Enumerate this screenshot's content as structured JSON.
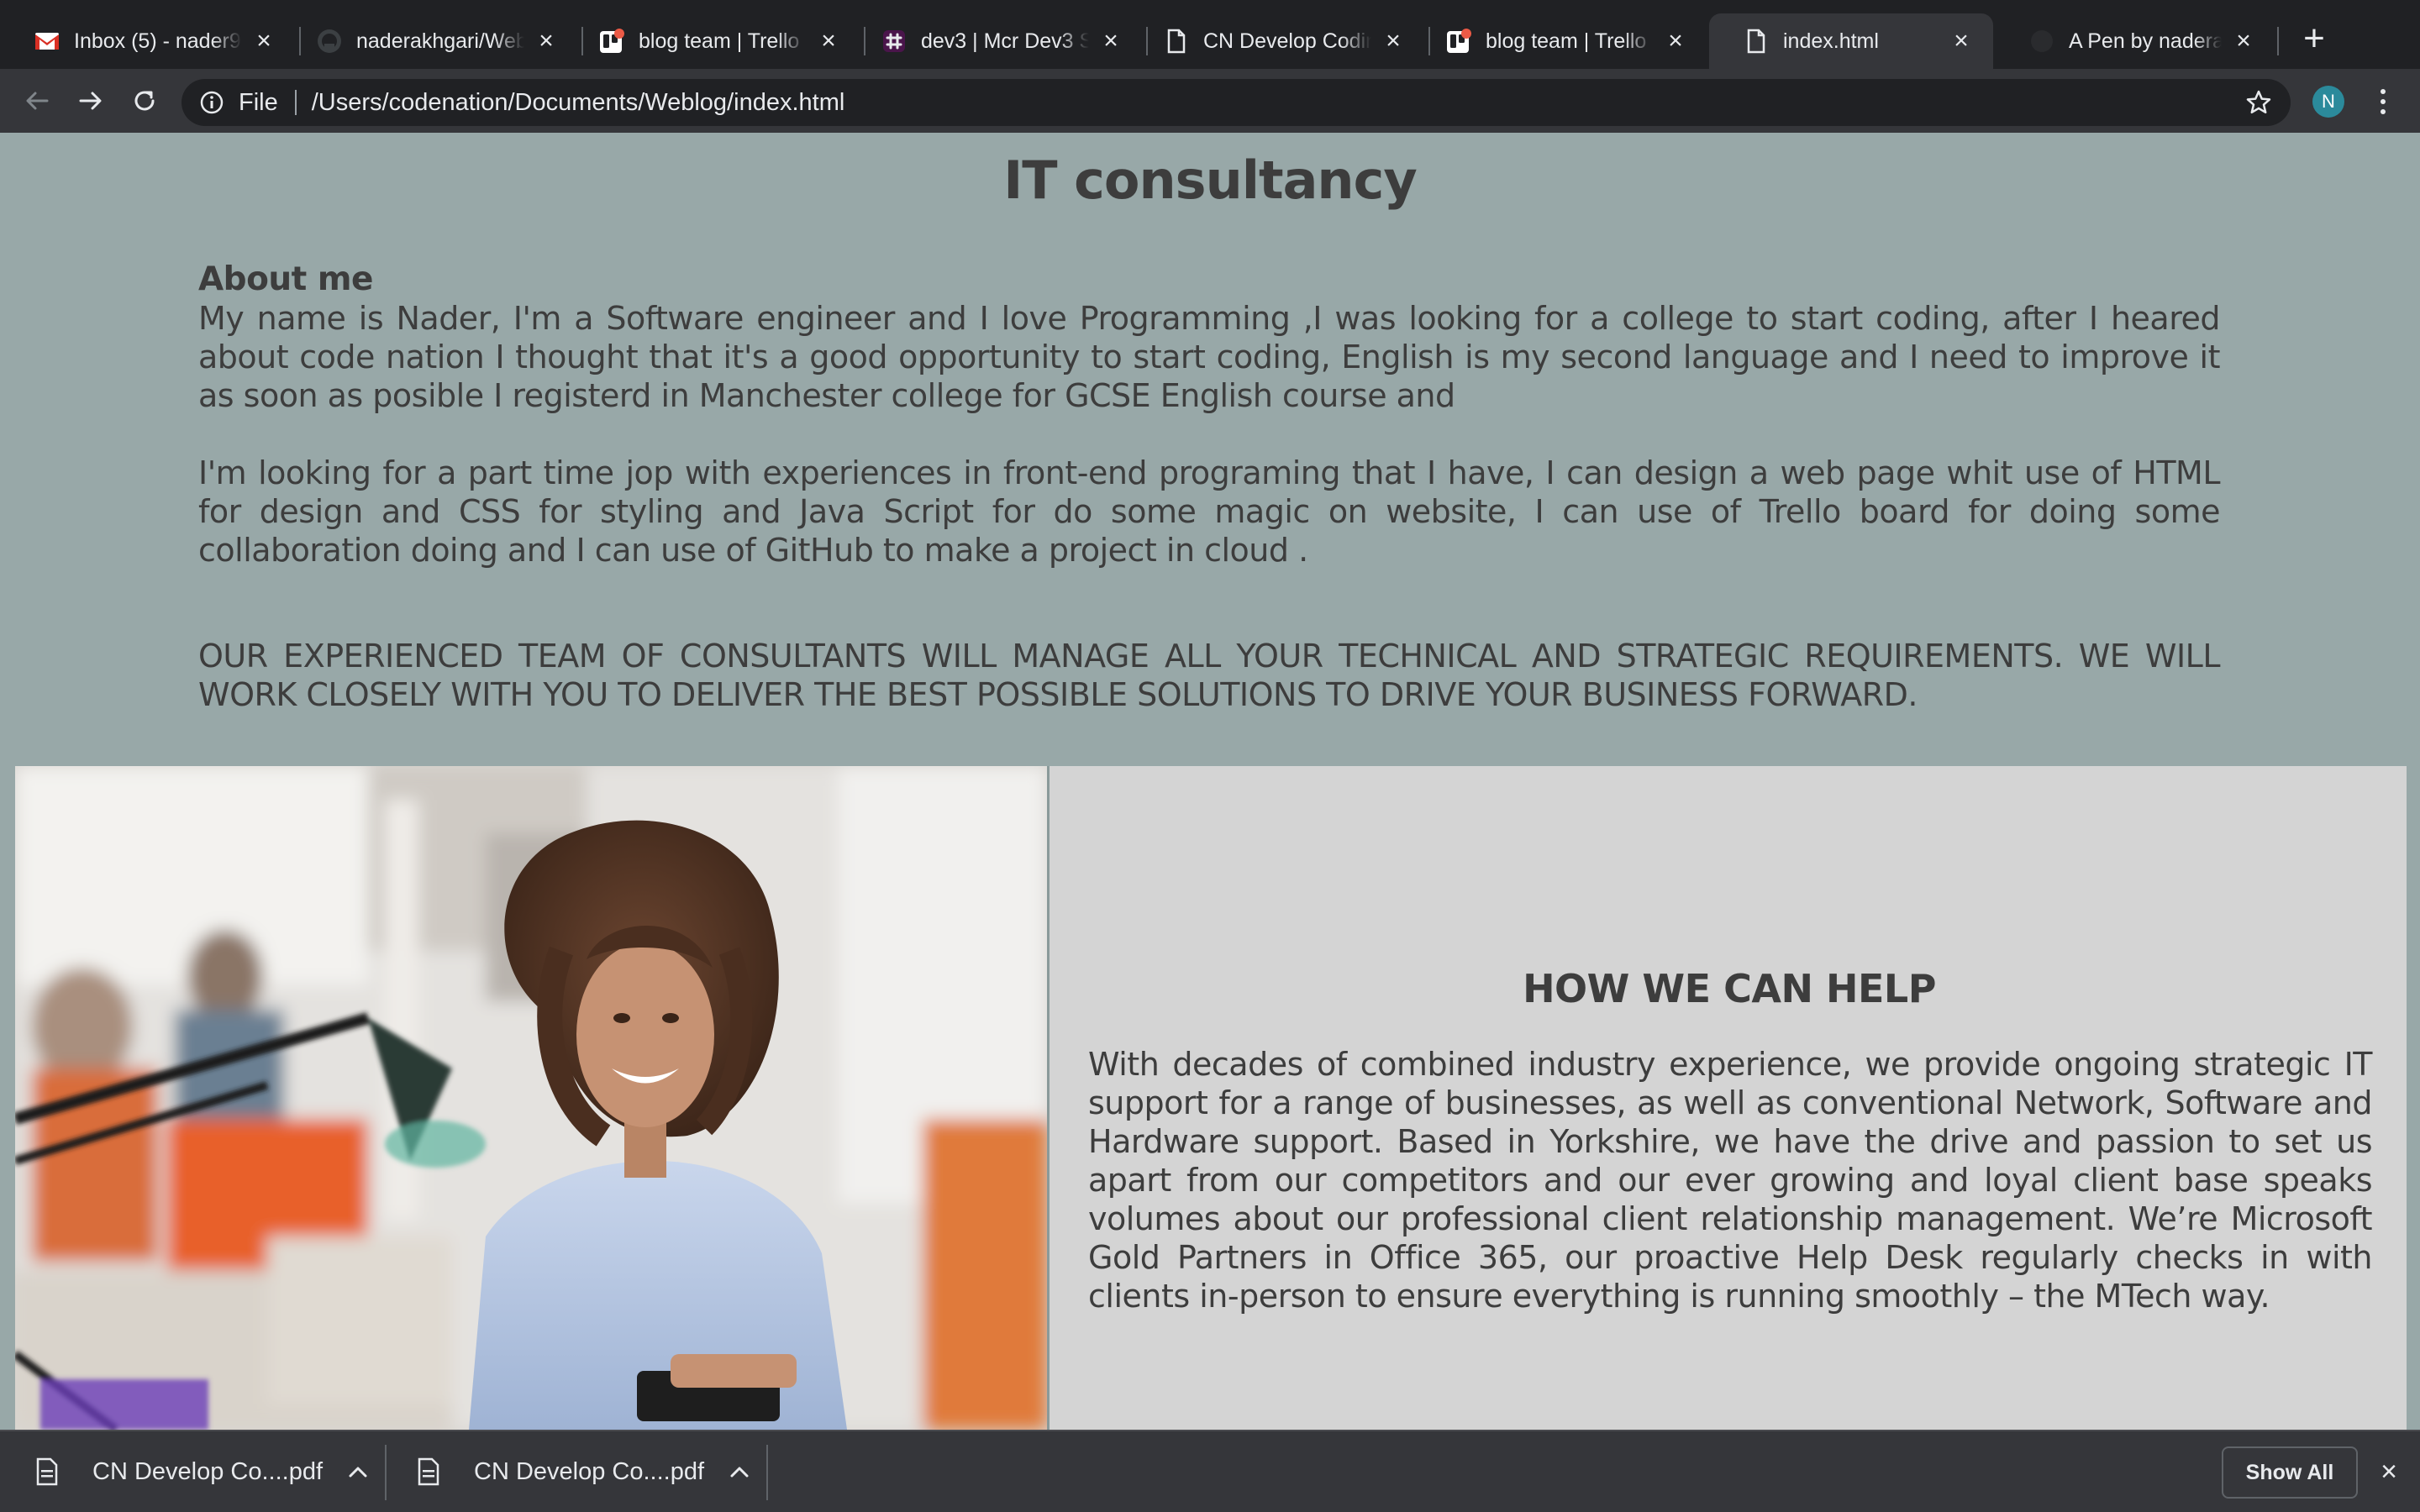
{
  "browser": {
    "tabs": [
      {
        "title": "Inbox (5) - nader9",
        "icon": "gmail-icon"
      },
      {
        "title": "naderakhgari/Web",
        "icon": "github-icon"
      },
      {
        "title": "blog team | Trello",
        "icon": "trello-icon"
      },
      {
        "title": "dev3 | Mcr Dev3 S",
        "icon": "slack-icon"
      },
      {
        "title": "CN Develop Codin",
        "icon": "document-icon"
      },
      {
        "title": "blog team | Trello",
        "icon": "trello-icon"
      },
      {
        "title": "index.html",
        "icon": "document-icon",
        "active": true
      },
      {
        "title": "A Pen by naderakh",
        "icon": "codepen-icon"
      }
    ],
    "address": {
      "scheme": "File",
      "url": "/Users/codenation/Documents/Weblog/index.html"
    },
    "profile_initial": "N"
  },
  "page": {
    "title": "IT consultancy",
    "about": {
      "heading": "About me",
      "paragraph1": "My name is Nader, I'm a Software engineer and I love Programming ,I was looking for a college to start coding, after I heared about code nation I thought that it's a good opportunity to start coding, English is my second language and I need to improve it as soon as posible I registerd in Manchester college for GCSE English course and",
      "paragraph2": "I'm looking for a part time jop with experiences in front-end programing that I have, I can design a web page whit use of HTML for design and CSS for styling and Java Script for do some magic on website, I can use of Trello board for doing some collaboration doing and I can use of GitHub to make a project in cloud ."
    },
    "tagline": "OUR EXPERIENCED TEAM OF CONSULTANTS WILL MANAGE ALL YOUR TECHNICAL AND STRATEGIC REQUIREMENTS. WE WILL WORK CLOSELY WITH YOU TO DELIVER THE BEST POSSIBLE SOLUTIONS TO DRIVE YOUR BUSINESS FORWARD.",
    "help": {
      "heading": "HOW WE CAN HELP",
      "text": "With decades of combined industry experience, we provide ongoing strategic IT support for a range of businesses, as well as conventional Network, Software and Hardware support. Based in Yorkshire, we have the drive and passion to set us apart from our competitors and our ever growing and loyal client base speaks volumes about our professional client relationship management. We’re Microsoft Gold Partners in Office 365, our proactive Help Desk regularly checks in with clients in-person to ensure everything is running smoothly – the MTech way."
    }
  },
  "downloads": {
    "items": [
      {
        "name": "CN Develop Co....pdf"
      },
      {
        "name": "CN Develop Co....pdf"
      }
    ],
    "show_all_label": "Show All"
  },
  "colors": {
    "page_background": "#98a8a8",
    "help_panel_background": "#d4d4d4",
    "text": "#3d3d3d",
    "chrome_dark": "#202124",
    "chrome_toolbar": "#35363a",
    "avatar": "#2b8a9b"
  }
}
